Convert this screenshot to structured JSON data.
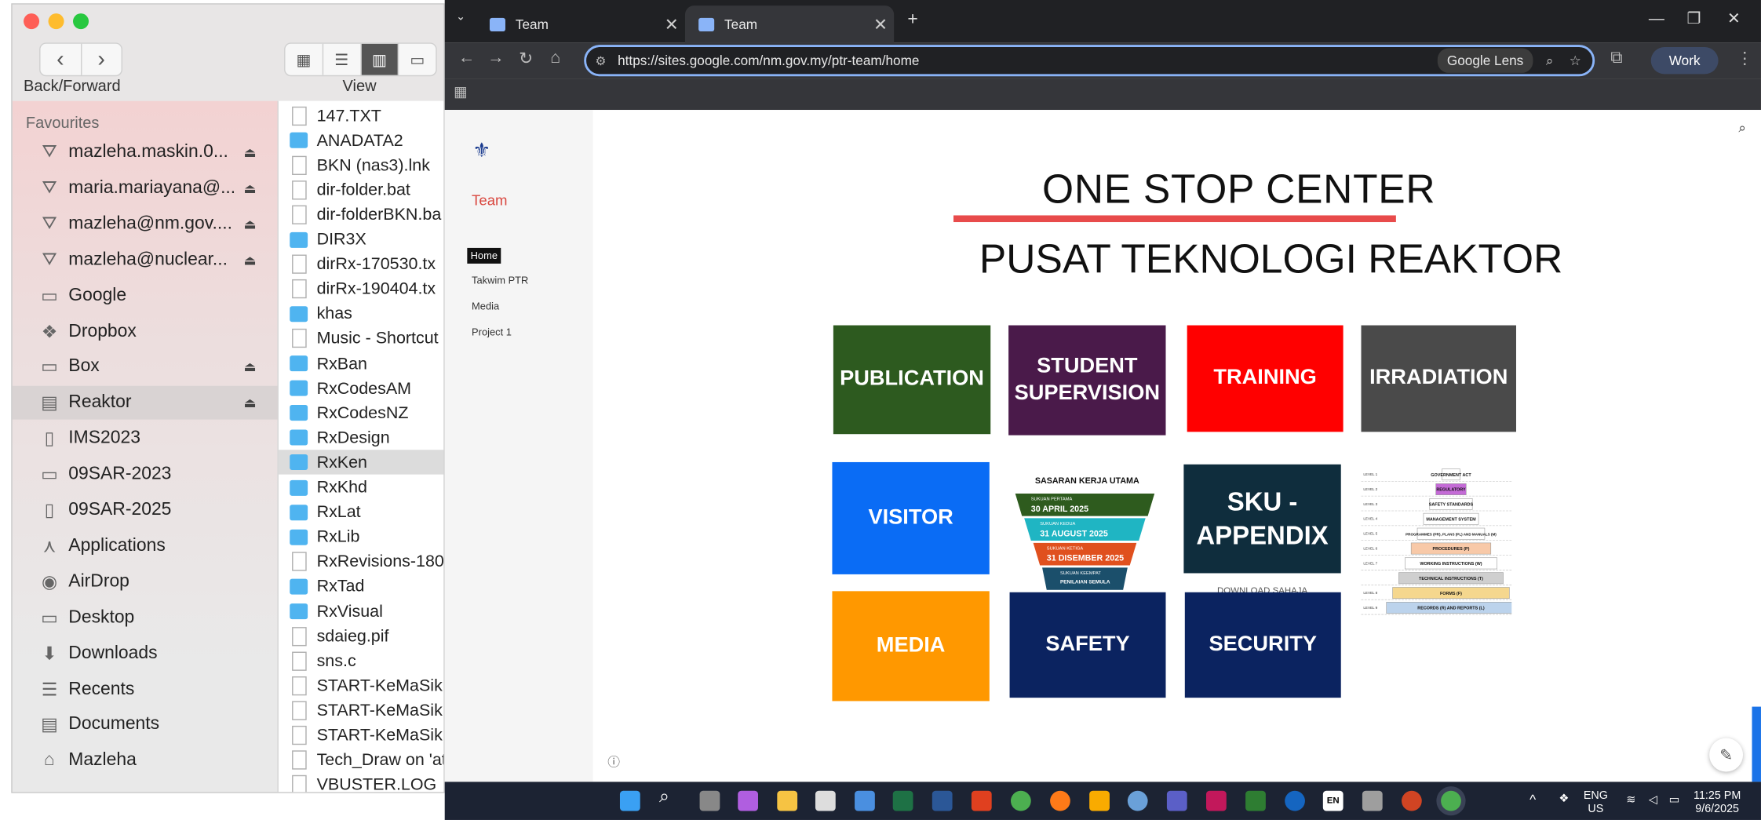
{
  "finder": {
    "toolbar": {
      "back_forward_label": "Back/Forward",
      "view_label": "View"
    },
    "sidebar": {
      "heading": "Favourites",
      "items": [
        {
          "label": "mazleha.maskin.0...",
          "icon": "cloud-drive-icon",
          "eject": "⏏"
        },
        {
          "label": "maria.mariayana@...",
          "icon": "cloud-drive-icon",
          "eject": "⏏"
        },
        {
          "label": "mazleha@nm.gov....",
          "icon": "cloud-drive-icon",
          "eject": "⏏"
        },
        {
          "label": "mazleha@nuclear...",
          "icon": "cloud-drive-icon",
          "eject": "⏏"
        },
        {
          "label": "Google",
          "icon": "folder-icon",
          "eject": ""
        },
        {
          "label": "Dropbox",
          "icon": "dropbox-icon",
          "eject": ""
        },
        {
          "label": "Box",
          "icon": "folder-icon",
          "eject": "⏏"
        },
        {
          "label": "Reaktor",
          "icon": "drive-icon",
          "eject": "⏏"
        },
        {
          "label": "IMS2023",
          "icon": "document-icon",
          "eject": ""
        },
        {
          "label": "09SAR-2023",
          "icon": "folder-icon",
          "eject": ""
        },
        {
          "label": "09SAR-2025",
          "icon": "document-icon",
          "eject": ""
        },
        {
          "label": "Applications",
          "icon": "applications-icon",
          "eject": ""
        },
        {
          "label": "AirDrop",
          "icon": "airdrop-icon",
          "eject": ""
        },
        {
          "label": "Desktop",
          "icon": "desktop-icon",
          "eject": ""
        },
        {
          "label": "Downloads",
          "icon": "downloads-icon",
          "eject": ""
        },
        {
          "label": "Recents",
          "icon": "recents-icon",
          "eject": ""
        },
        {
          "label": "Documents",
          "icon": "documents-icon",
          "eject": ""
        },
        {
          "label": "Mazleha",
          "icon": "home-icon",
          "eject": ""
        }
      ]
    },
    "files": [
      {
        "name": "147.TXT",
        "kind": "file"
      },
      {
        "name": "ANADATA2",
        "kind": "folder"
      },
      {
        "name": "BKN (nas3).lnk",
        "kind": "file"
      },
      {
        "name": "dir-folder.bat",
        "kind": "file"
      },
      {
        "name": "dir-folderBKN.ba",
        "kind": "file"
      },
      {
        "name": "DIR3X",
        "kind": "folder"
      },
      {
        "name": "dirRx-170530.tx",
        "kind": "file"
      },
      {
        "name": "dirRx-190404.tx",
        "kind": "file"
      },
      {
        "name": "khas",
        "kind": "folder"
      },
      {
        "name": "Music - Shortcut",
        "kind": "file"
      },
      {
        "name": "RxBan",
        "kind": "folder"
      },
      {
        "name": "RxCodesAM",
        "kind": "folder"
      },
      {
        "name": "RxCodesNZ",
        "kind": "folder"
      },
      {
        "name": "RxDesign",
        "kind": "folder"
      },
      {
        "name": "RxKen",
        "kind": "folder"
      },
      {
        "name": "RxKhd",
        "kind": "folder"
      },
      {
        "name": "RxLat",
        "kind": "folder"
      },
      {
        "name": "RxLib",
        "kind": "folder"
      },
      {
        "name": "RxRevisions-180",
        "kind": "file"
      },
      {
        "name": "RxTad",
        "kind": "folder"
      },
      {
        "name": "RxVisual",
        "kind": "folder"
      },
      {
        "name": "sdaieg.pif",
        "kind": "file"
      },
      {
        "name": "sns.c",
        "kind": "file"
      },
      {
        "name": "START-KeMaSik.",
        "kind": "file"
      },
      {
        "name": "START-KeMaSik.",
        "kind": "file"
      },
      {
        "name": "START-KeMaSik",
        "kind": "file"
      },
      {
        "name": "Tech_Draw on 'at",
        "kind": "file"
      },
      {
        "name": "VBUSTER.LOG",
        "kind": "file"
      }
    ],
    "selected_file": "RxKen",
    "selected_sidebar": "Reaktor"
  },
  "browser": {
    "tabs": [
      {
        "title": "Team"
      },
      {
        "title": "Team"
      }
    ],
    "new_tab": "+",
    "url": "https://sites.google.com/nm.gov.my/ptr-team/home",
    "lens_label": "Google Lens",
    "profile_label": "Work"
  },
  "site": {
    "team_name": "Team",
    "nav": [
      "Home",
      "Takwim PTR",
      "Media",
      "Project 1"
    ],
    "heading1": "ONE STOP CENTER",
    "heading2": "PUSAT TEKNOLOGI REAKTOR",
    "tiles": [
      {
        "label": "PUBLICATION",
        "color": "#2d5a1f"
      },
      {
        "label": "STUDENT SUPERVISION",
        "color": "#4a1a4a"
      },
      {
        "label": "TRAINING",
        "color": "#ff0000"
      },
      {
        "label": "IRRADIATION",
        "color": "#4a4a4a"
      },
      {
        "label": "VISITOR",
        "color": "#0a6cf5"
      },
      {
        "label": "SKU - APPENDIX",
        "color": "#0f2d3d"
      },
      {
        "label": "MEDIA",
        "color": "#ff9800"
      },
      {
        "label": "SAFETY",
        "color": "#0b2360"
      },
      {
        "label": "SECURITY",
        "color": "#0b2360"
      }
    ],
    "sku_caption": "DOWNLOAD SAHAJA",
    "funnel": {
      "title": "SASARAN KERJA UTAMA",
      "steps": [
        {
          "sub": "SUKUAN PERTAMA",
          "date": "30 APRIL 2025",
          "color": "#2e5b1e"
        },
        {
          "sub": "SUKUAN KEDUA",
          "date": "31 AUGUST 2025",
          "color": "#1fb5c3"
        },
        {
          "sub": "SUKUAN KETIGA",
          "date": "31 DISEMBER 2025",
          "color": "#e0501e"
        },
        {
          "sub": "SUKUAN KEEMPAT",
          "date": "PENILAIAN SEMULA",
          "color": "#1b4f6b"
        }
      ]
    },
    "pyramid": {
      "levels": [
        {
          "level": "LEVEL 1",
          "text": "GOVERNMENT ACT"
        },
        {
          "level": "LEVEL 2",
          "text": "REGULATORY"
        },
        {
          "level": "LEVEL 3",
          "text": "SAFETY STANDARDS"
        },
        {
          "level": "LEVEL 4",
          "text": "MANAGEMENT SYSTEM"
        },
        {
          "level": "LEVEL 5",
          "text": "PROGRAMMES (PR), PLANS (PL) AND MANUALS (M)"
        },
        {
          "level": "LEVEL 6",
          "text": "PROCEDURES (P)"
        },
        {
          "level": "LEVEL 7",
          "text": "WORKING INSTRUCTIONS (W)"
        },
        {
          "level": "",
          "text": "TECHNICAL INSTRUCTIONS (T)"
        },
        {
          "level": "LEVEL 8",
          "text": "FORMS (F)"
        },
        {
          "level": "LEVEL 9",
          "text": "RECORDS (R) AND REPORTS (L)"
        }
      ]
    }
  },
  "taskbar": {
    "lang": "ENG",
    "region": "US",
    "time": "11:25 PM",
    "date": "9/6/2025"
  }
}
